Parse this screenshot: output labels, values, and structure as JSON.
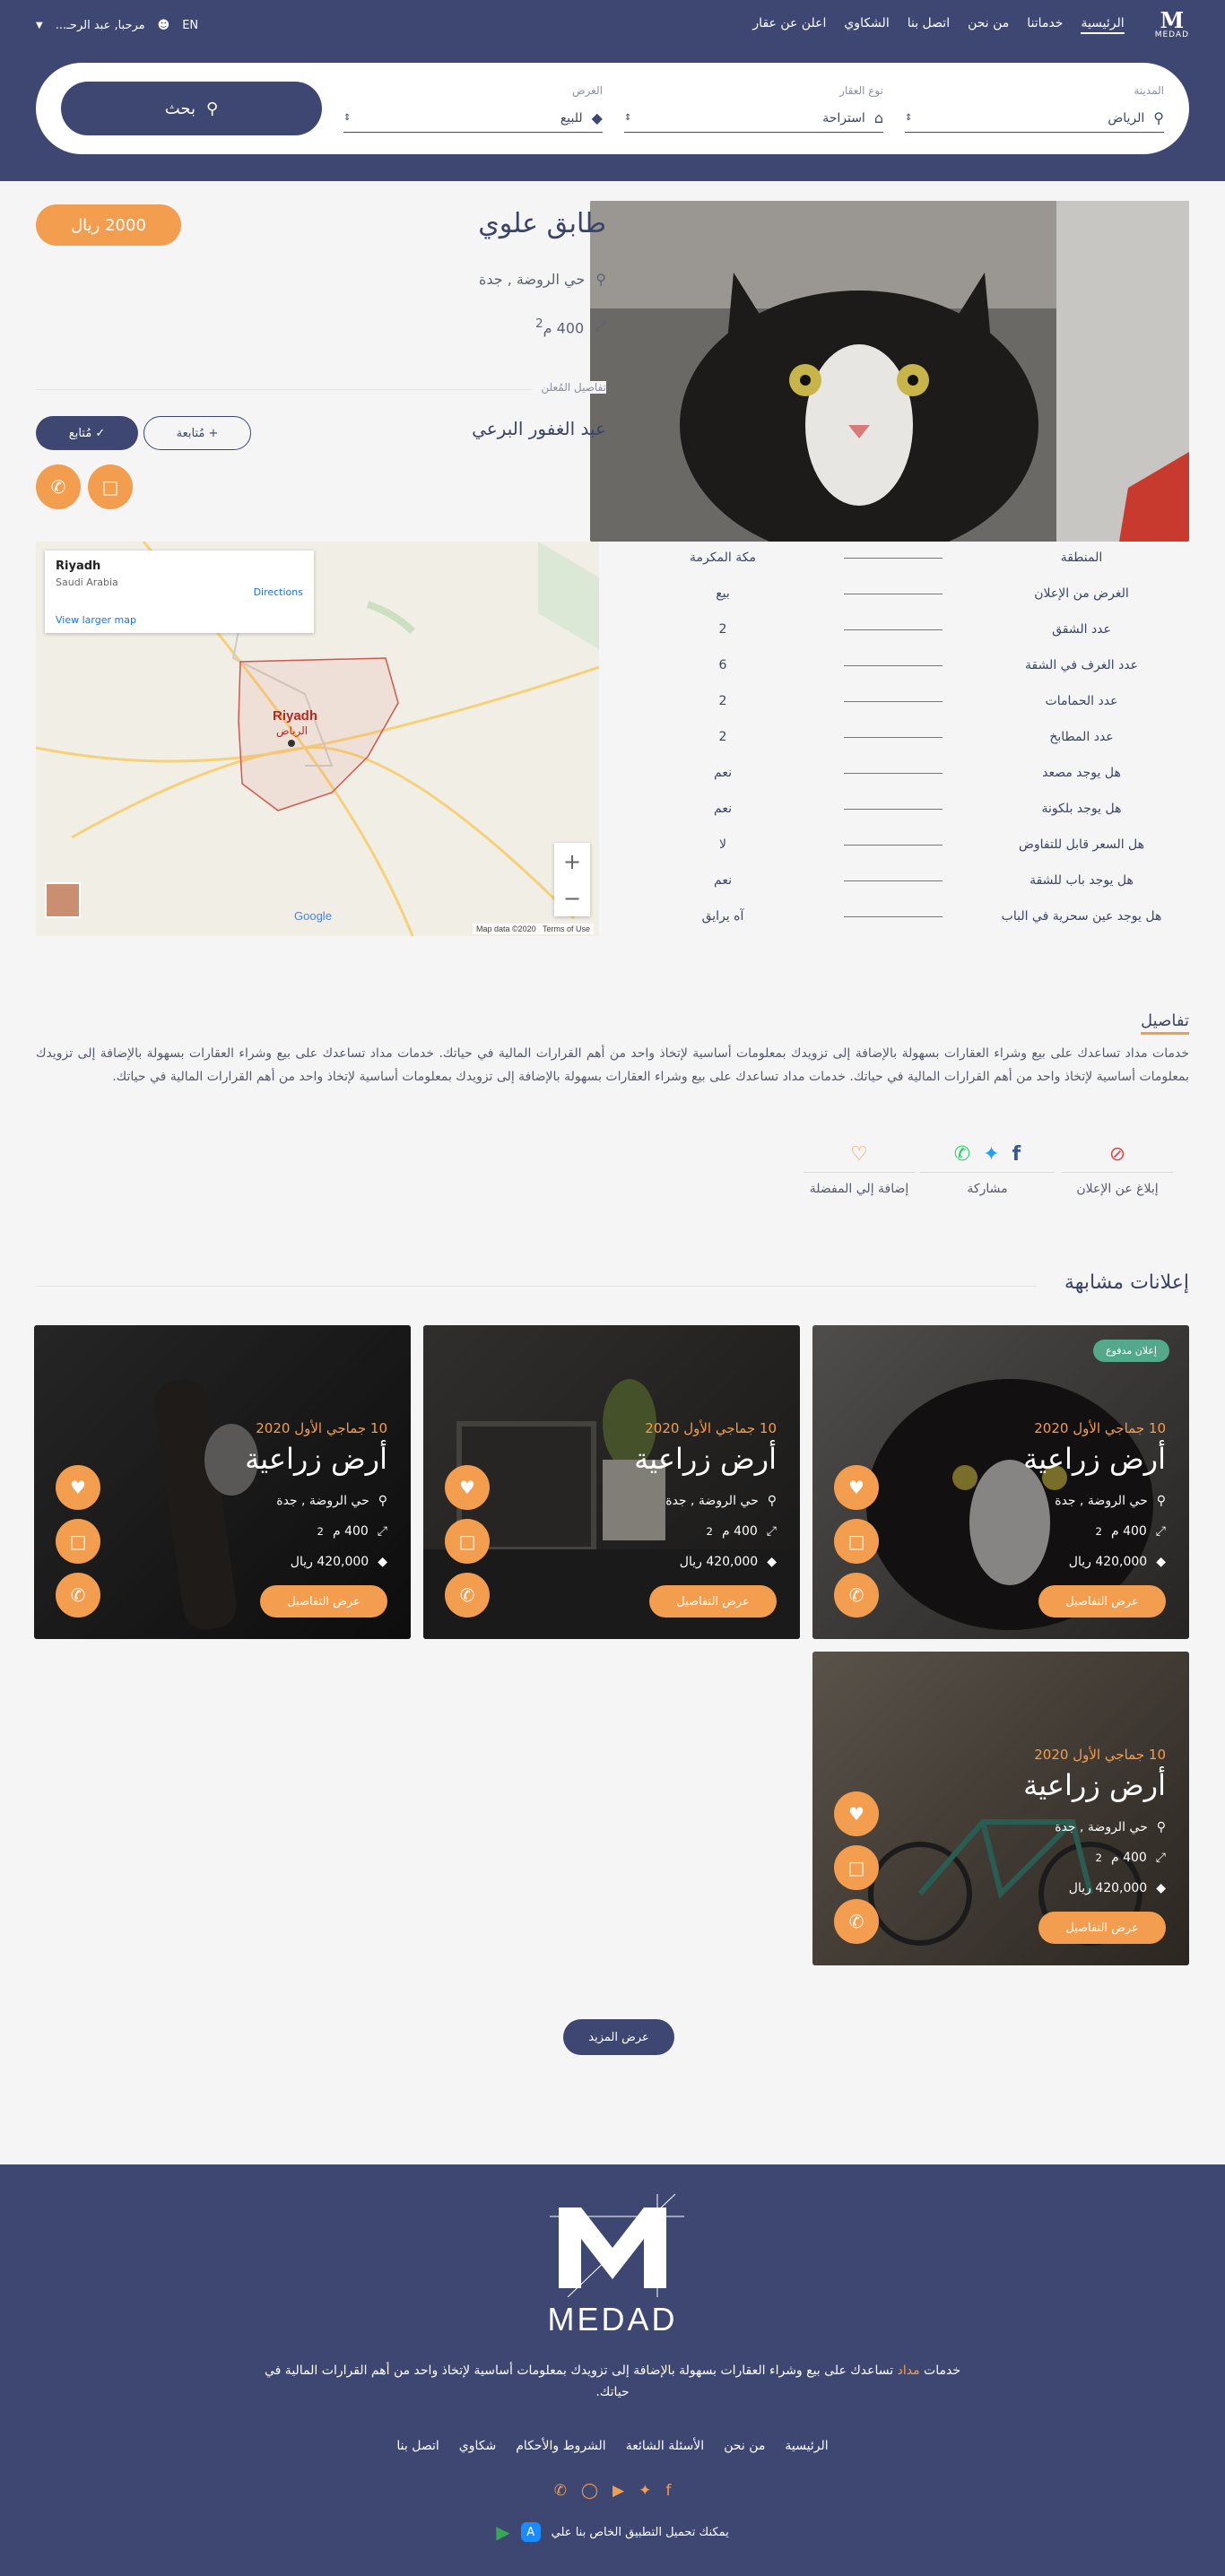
{
  "nav": {
    "logo_text": "MEDAD",
    "links": [
      "الرئيسية",
      "خدماتنا",
      "من نحن",
      "اتصل بنا",
      "الشكاوي",
      "اعلن عن عقار"
    ],
    "user_greeting": "مرحبا, عبد الرحـ...",
    "lang": "EN"
  },
  "search": {
    "city_label": "المدينة",
    "city_value": "الرياض",
    "type_label": "نوع العقار",
    "type_value": "استراحة",
    "purpose_label": "الغرض",
    "purpose_value": "للبيع",
    "button": "بحث"
  },
  "listing": {
    "title": "طابق علوي",
    "price": "2000 ريال",
    "location": "حي الروضة , جدة",
    "area": "400 م",
    "area_sup": "2",
    "advertiser_label": "تفاصيل المُعلن",
    "owner": "عبد الغفور البرعي",
    "follow": "مُتابعة",
    "following": "مُتابع"
  },
  "map": {
    "place": "Riyadh",
    "country": "Saudi Arabia",
    "directions": "Directions",
    "larger": "View larger map",
    "city_label": "Riyadh",
    "city_label_ar": "الرياض",
    "footer_data": "Map data ©2020",
    "terms": "Terms of Use",
    "google": "Google"
  },
  "specs": [
    {
      "k": "المنطقة",
      "v": "مكة المكرمة"
    },
    {
      "k": "الغرض من الإعلان",
      "v": "بيع"
    },
    {
      "k": "عدد الشقق",
      "v": "2"
    },
    {
      "k": "عدد الغرف في الشقة",
      "v": "6"
    },
    {
      "k": "عدد الحمامات",
      "v": "2"
    },
    {
      "k": "عدد المطابخ",
      "v": "2"
    },
    {
      "k": "هل يوجد مصعد",
      "v": "نعم"
    },
    {
      "k": "هل يوجد بلكونة",
      "v": "نعم"
    },
    {
      "k": "هل السعر قابل للتفاوض",
      "v": "لا"
    },
    {
      "k": "هل يوجد باب للشقة",
      "v": "نعم"
    },
    {
      "k": "هل يوجد عين سحرية في الباب",
      "v": "آه يرايق"
    }
  ],
  "about": {
    "title": "تفاصيل",
    "text": "خدمات مداد تساعدك على بيع وشراء العقارات بسهولة بالإضافة إلى تزويدك بمعلومات أساسية لإتخاذ واحد من أهم القرارات المالية في حياتك. خدمات مداد تساعدك على بيع وشراء العقارات بسهولة بالإضافة إلى تزويدك بمعلومات أساسية لإتخاذ واحد من أهم القرارات المالية في حياتك. خدمات مداد تساعدك على بيع وشراء العقارات بسهولة بالإضافة إلى تزويدك بمعلومات أساسية لإتخاذ واحد من أهم القرارات المالية في حياتك."
  },
  "actions": {
    "report": "إبلاغ عن الإعلان",
    "share": "مشاركة",
    "favorite": "إضافة إلي المفضلة"
  },
  "similar": {
    "title": "إعلانات مشابهة",
    "badge": "إعلان مدفوع",
    "cards": [
      {
        "date": "10 جماجي الأول 2020",
        "title": "أرض زراعية",
        "loc": "حي الروضة , جدة",
        "area": "400 م",
        "price": "420,000 ريال",
        "btn": "عرض التفاصيل"
      },
      {
        "date": "10 جماجي الأول 2020",
        "title": "أرض زراعية",
        "loc": "حي الروضة , جدة",
        "area": "400 م",
        "price": "420,000 ريال",
        "btn": "عرض التفاصيل"
      },
      {
        "date": "10 جماجي الأول 2020",
        "title": "أرض زراعية",
        "loc": "حي الروضة , جدة",
        "area": "400 م",
        "price": "420,000 ريال",
        "btn": "عرض التفاصيل"
      },
      {
        "date": "10 جماجي الأول 2020",
        "title": "أرض زراعية",
        "loc": "حي الروضة , جدة",
        "area": "400 م",
        "price": "420,000 ريال",
        "btn": "عرض التفاصيل"
      }
    ],
    "more": "عرض المزيد"
  },
  "footer": {
    "logo": "MEDAD",
    "desc_pre": "خدمات ",
    "desc_brand": "مداد",
    "desc_post": " تساعدك على بيع وشراء العقارات بسهولة بالإضافة إلى تزويدك بمعلومات أساسية لإتخاذ واحد من أهم القرارات المالية في حياتك.",
    "links": [
      "الرئيسية",
      "من نحن",
      "الأسئلة الشائعة",
      "الشروط والأحكام",
      "شكاوي",
      "اتصل بنا"
    ],
    "app_text": "يمكنك تحميل التطبيق الخاص بنا علي"
  }
}
